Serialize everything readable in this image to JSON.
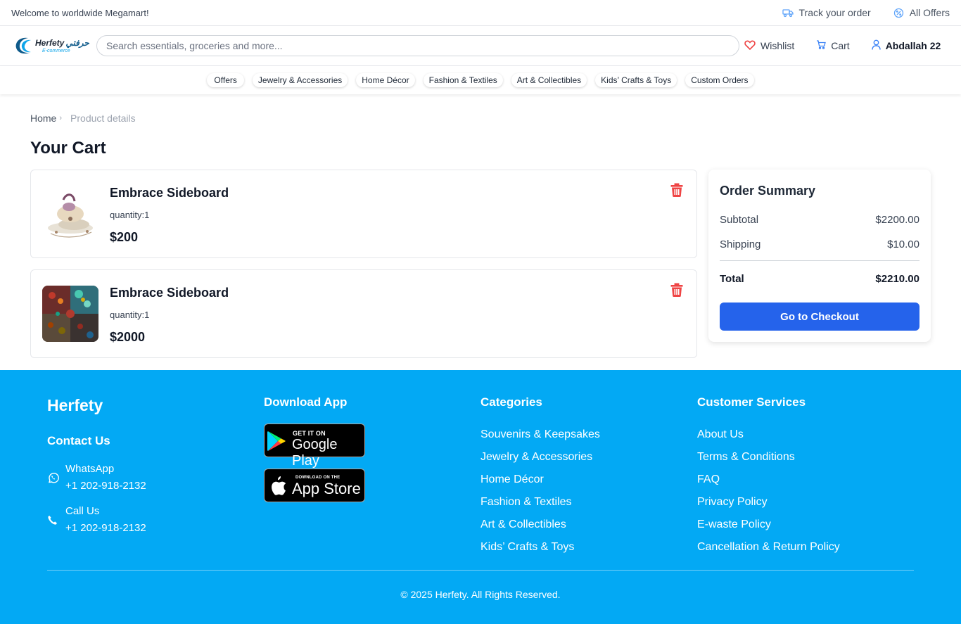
{
  "topbar": {
    "welcome": "Welcome to worldwide Megamart!",
    "track_order": "Track your order",
    "all_offers": "All Offers"
  },
  "header": {
    "logo_latin": "Herfety",
    "logo_arabic": "حرفتي",
    "logo_sub": "E-commerce",
    "search_placeholder": "Search essentials, groceries and more...",
    "wishlist": "Wishlist",
    "cart": "Cart",
    "user": "Abdallah 22"
  },
  "categories": [
    "Offers",
    "Jewelry & Accessories",
    "Home Décor",
    "Fashion & Textiles",
    "Art & Collectibles",
    "Kids’ Crafts & Toys",
    "Custom Orders"
  ],
  "breadcrumb": {
    "home": "Home",
    "current": "Product details"
  },
  "page_title": "Your Cart",
  "cart_items": [
    {
      "name": "Embrace Sideboard",
      "quantity": "quantity:1",
      "price": "$200"
    },
    {
      "name": "Embrace Sideboard",
      "quantity": "quantity:1",
      "price": "$2000"
    }
  ],
  "summary": {
    "title": "Order Summary",
    "subtotal_label": "Subtotal",
    "subtotal_value": "$2200.00",
    "shipping_label": "Shipping",
    "shipping_value": "$10.00",
    "total_label": "Total",
    "total_value": "$2210.00",
    "checkout_label": "Go to Checkout"
  },
  "footer": {
    "brand": "Herfety",
    "contact_title": "Contact Us",
    "whatsapp_label": "WhatsApp",
    "whatsapp_number": "+1 202-918-2132",
    "call_label": "Call Us",
    "call_number": "+1 202-918-2132",
    "download_title": "Download App",
    "google_play_small": "GET IT ON",
    "google_play_big": "Google Play",
    "app_store_small": "DOWNLOAD ON THE",
    "app_store_big": "App Store",
    "categories_title": "Categories",
    "categories": [
      "Souvenirs & Keepsakes",
      "Jewelry & Accessories",
      "Home Décor",
      "Fashion & Textiles",
      "Art & Collectibles",
      "Kids’ Crafts & Toys"
    ],
    "services_title": "Customer Services",
    "services": [
      "About Us",
      "Terms & Conditions",
      "FAQ",
      "Privacy Policy",
      "E-waste Policy",
      "Cancellation & Return Policy"
    ],
    "copyright": "© 2025 Herfety. All Rights Reserved."
  },
  "colors": {
    "primary_button": "#2563eb",
    "footer_bg": "#03a9f4",
    "delete_red": "#ef4444",
    "wishlist_red": "#ef4444"
  },
  "icons": [
    "truck-icon",
    "offer-badge-icon",
    "heart-icon",
    "cart-icon",
    "user-icon",
    "chevron-right-icon",
    "trash-icon",
    "whatsapp-icon",
    "phone-icon",
    "google-play-icon",
    "apple-icon"
  ]
}
